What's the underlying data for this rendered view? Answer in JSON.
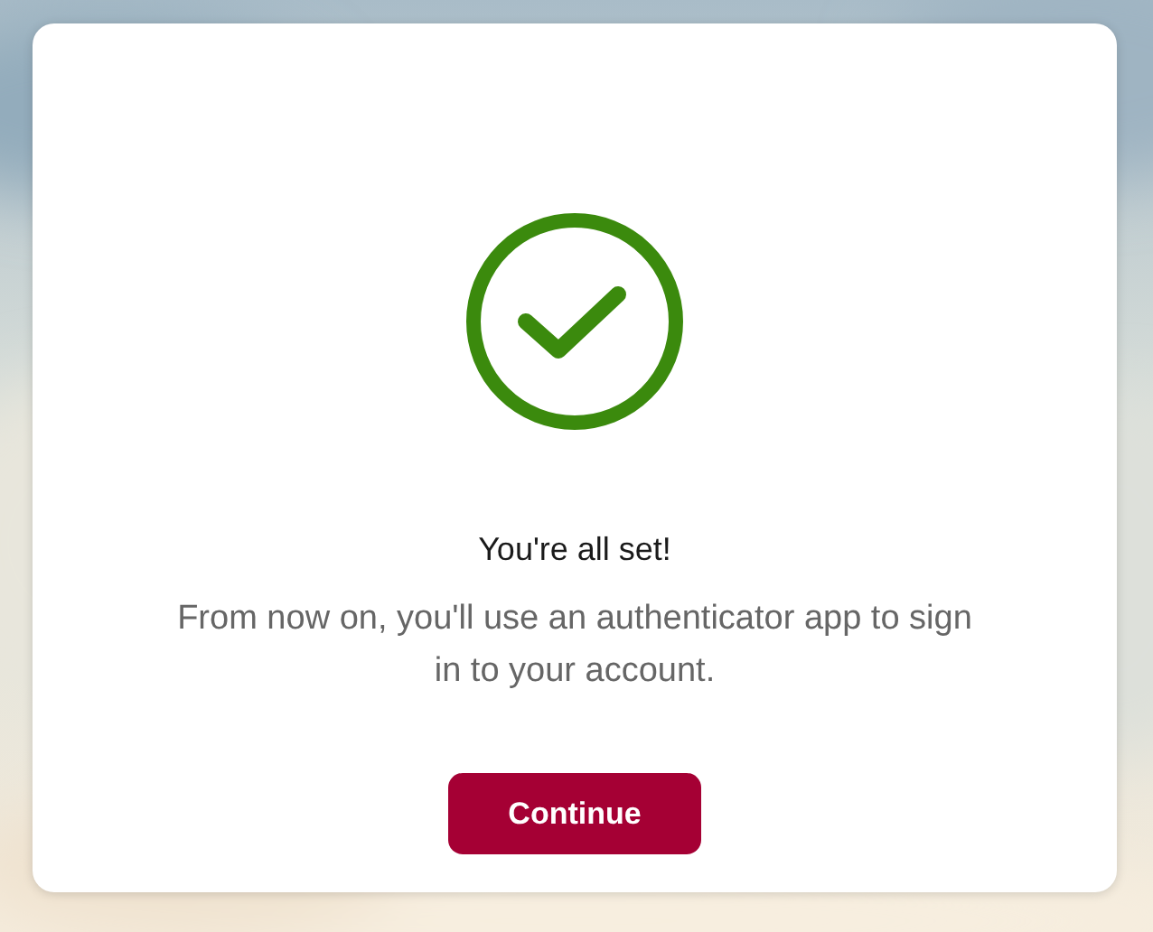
{
  "card": {
    "title": "You're all set!",
    "message": "From now on, you'll use an authenticator app to sign in to your account.",
    "button": "Continue"
  }
}
